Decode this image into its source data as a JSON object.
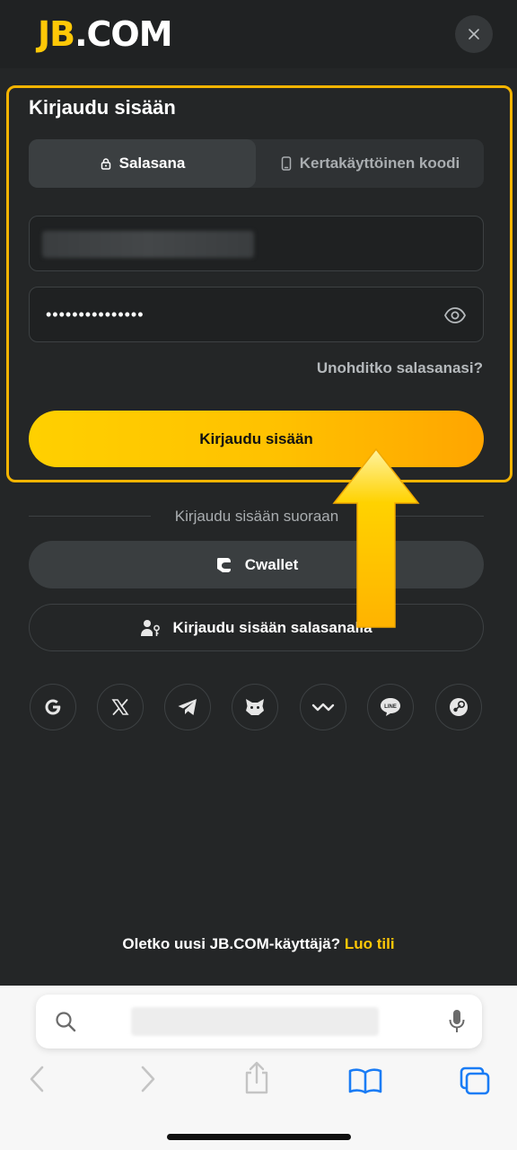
{
  "header": {
    "logo_jb": "JB",
    "logo_com": ".COM",
    "close_icon": "close-icon"
  },
  "login": {
    "title": "Kirjaudu sisään",
    "tabs": [
      {
        "label": "Salasana",
        "icon": "lock-icon",
        "active": true
      },
      {
        "label": "Kertakäyttöinen koodi",
        "icon": "phone-icon",
        "active": false
      }
    ],
    "username_value": "",
    "password_value": "•••••••••••••••",
    "forgot_label": "Unohditko salasanasi?",
    "submit_label": "Kirjaudu sisään"
  },
  "direct": {
    "divider_label": "Kirjaudu sisään suoraan",
    "cwallet_label": "Cwallet",
    "password_login_label": "Kirjaudu sisään salasanalla"
  },
  "socials": [
    "google-icon",
    "x-icon",
    "telegram-icon",
    "metamask-icon",
    "walletconnect-icon",
    "line-icon",
    "steam-icon"
  ],
  "footer": {
    "signup_text": "Oletko uusi JB.COM-käyttäjä?",
    "signup_link": "Luo tili"
  },
  "colors": {
    "accent": "#ffc807",
    "background": "#242627",
    "highlight": "#f5b400"
  }
}
